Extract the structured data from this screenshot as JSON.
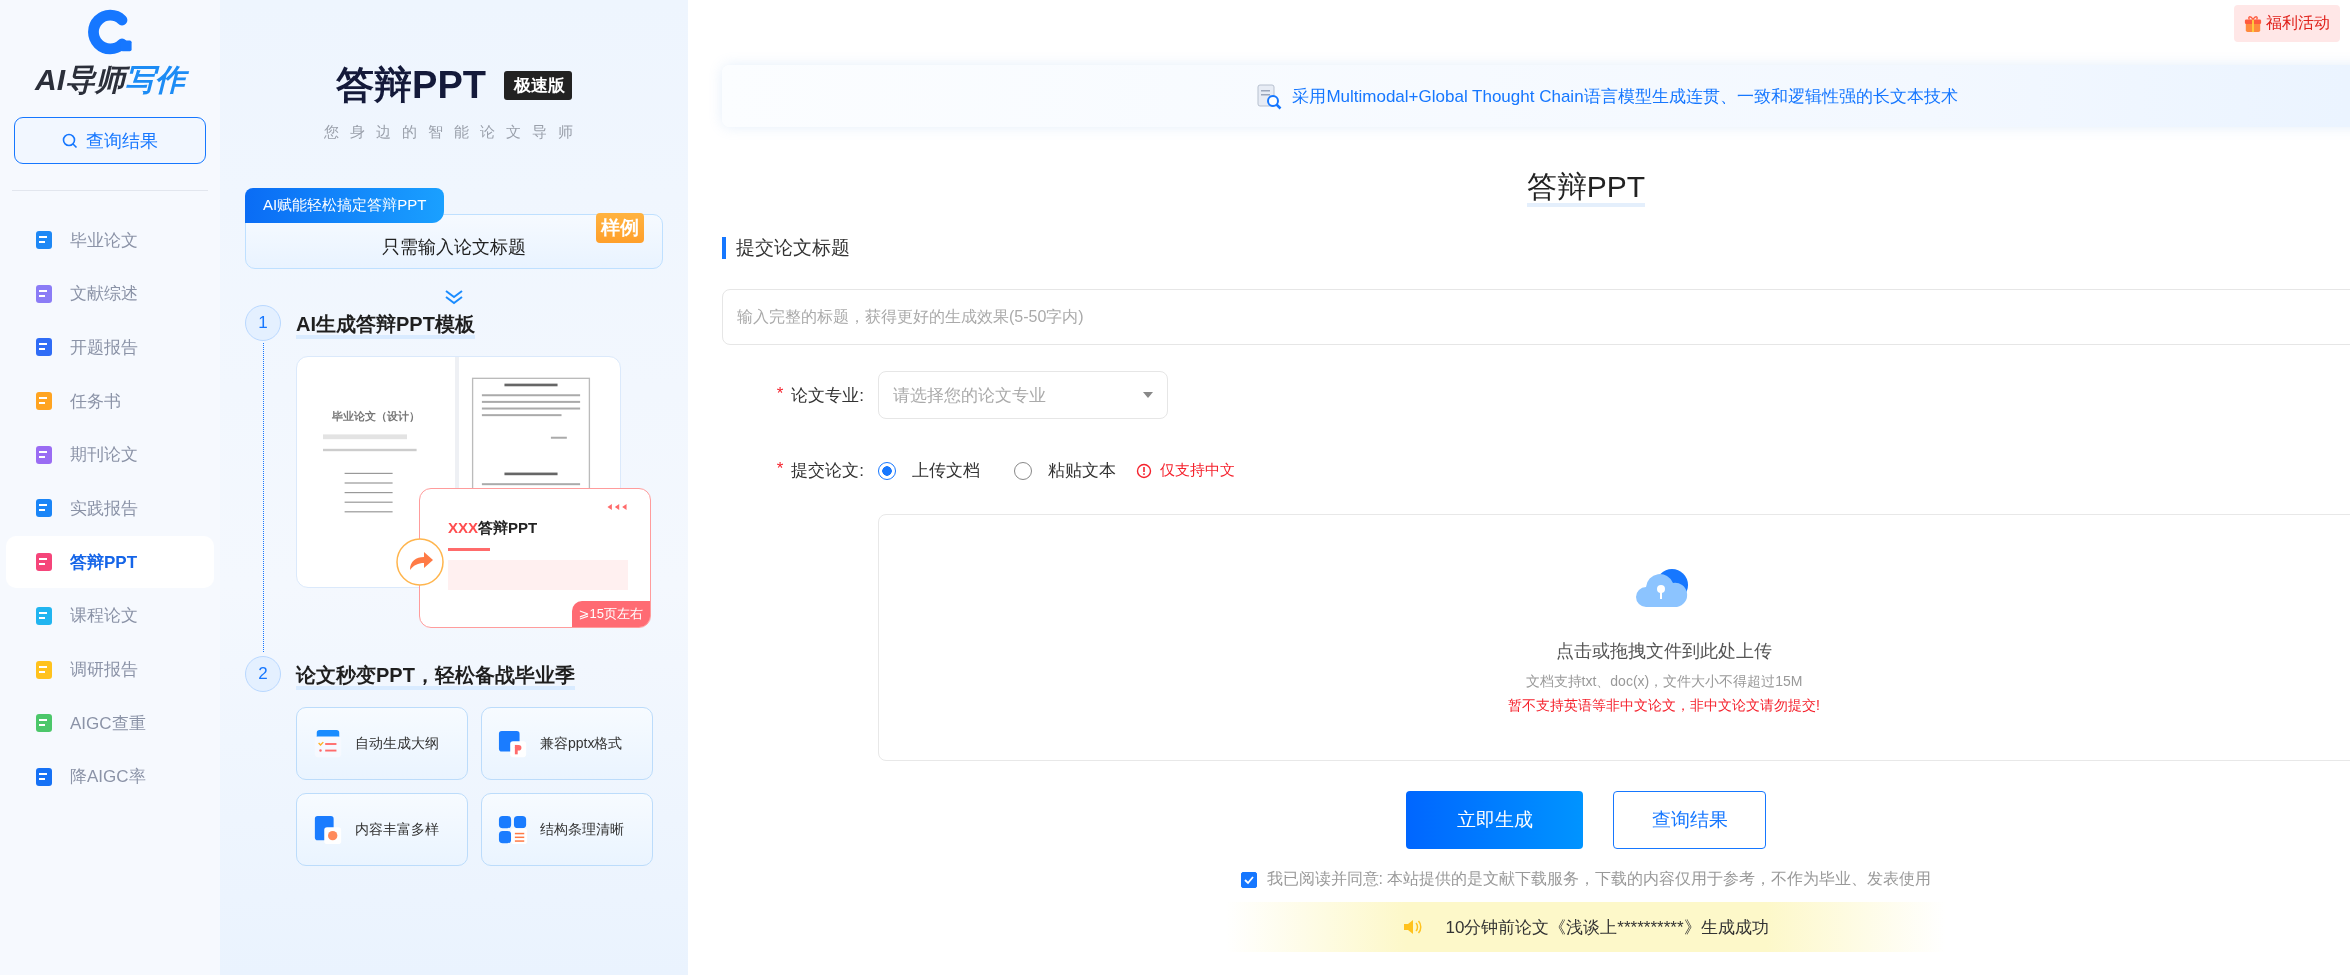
{
  "logo": {
    "text_parts": [
      "AI导师",
      "写作"
    ]
  },
  "sidebar": {
    "search_button": "查询结果",
    "items": [
      {
        "label": "毕业论文",
        "selected": false,
        "color": "#1e88f5"
      },
      {
        "label": "文献综述",
        "selected": false,
        "color": "#8b7cf6"
      },
      {
        "label": "开题报告",
        "selected": false,
        "color": "#2f6cf6"
      },
      {
        "label": "任务书",
        "selected": false,
        "color": "#ffa421"
      },
      {
        "label": "期刊论文",
        "selected": false,
        "color": "#9a6cf3"
      },
      {
        "label": "实践报告",
        "selected": false,
        "color": "#1a85f7"
      },
      {
        "label": "答辩PPT",
        "selected": true,
        "color": "#f5457a"
      },
      {
        "label": "课程论文",
        "selected": false,
        "color": "#21b5f0"
      },
      {
        "label": "调研报告",
        "selected": false,
        "color": "#ffc21e"
      },
      {
        "label": "AIGC查重",
        "selected": false,
        "color": "#4cc76a"
      },
      {
        "label": "降AIGC率",
        "selected": false,
        "color": "#1671f5"
      }
    ]
  },
  "promo": {
    "title": "答辩PPT",
    "edition": "极速版",
    "subtitle": "您身边的智能论文导师",
    "card": {
      "tab": "AI赋能轻松搞定答辩PPT",
      "text": "只需输入论文标题",
      "badge": "样例"
    },
    "steps": [
      {
        "number": "1",
        "title": "AI生成答辩PPT模板"
      },
      {
        "number": "2",
        "title": "论文秒变PPT，轻松备战毕业季"
      }
    ],
    "sample": {
      "doc_title": "毕业论文（设计）",
      "slide_title_parts": [
        "XXX",
        "答辩PPT"
      ],
      "pages": "⩾15页左右"
    },
    "features": [
      {
        "label": "自动生成大纲",
        "kind": "outline"
      },
      {
        "label": "兼容pptx格式",
        "kind": "pptx"
      },
      {
        "label": "内容丰富多样",
        "kind": "chart"
      },
      {
        "label": "结构条理清晰",
        "kind": "grid"
      }
    ]
  },
  "top_bar": {
    "benefits_button": "福利活动"
  },
  "banner": "采用Multimodal+Global Thought Chain语言模型生成连贯、一致和逻辑性强的长文本技术",
  "form": {
    "title": "答辩PPT",
    "section": "提交论文标题",
    "title_input": {
      "placeholder": "输入完整的标题，获得更好的生成效果(5-50字内)"
    },
    "major": {
      "required_mark": "*",
      "label": "论文专业:",
      "placeholder": "请选择您的论文专业"
    },
    "submit": {
      "required_mark": "*",
      "label": "提交论文:",
      "options": [
        {
          "label": "上传文档",
          "selected": true
        },
        {
          "label": "粘贴文本",
          "selected": false
        }
      ],
      "note": "仅支持中文"
    },
    "upload": {
      "title": "点击或拖拽文件到此处上传",
      "hint": "文档支持txt、doc(x)，文件大小不得超过15M",
      "warning": "暂不支持英语等非中文论文，非中文论文请勿提交!"
    },
    "buttons": [
      {
        "label": "立即生成",
        "kind": "primary"
      },
      {
        "label": "查询结果",
        "kind": "secondary"
      }
    ],
    "agreement": {
      "checked": true,
      "text": "我已阅读并同意: 本站提供的是文献下载服务，下载的内容仅用于参考，不作为毕业、发表使用"
    },
    "notice": "10分钟前论文《浅谈上**********》生成成功"
  }
}
